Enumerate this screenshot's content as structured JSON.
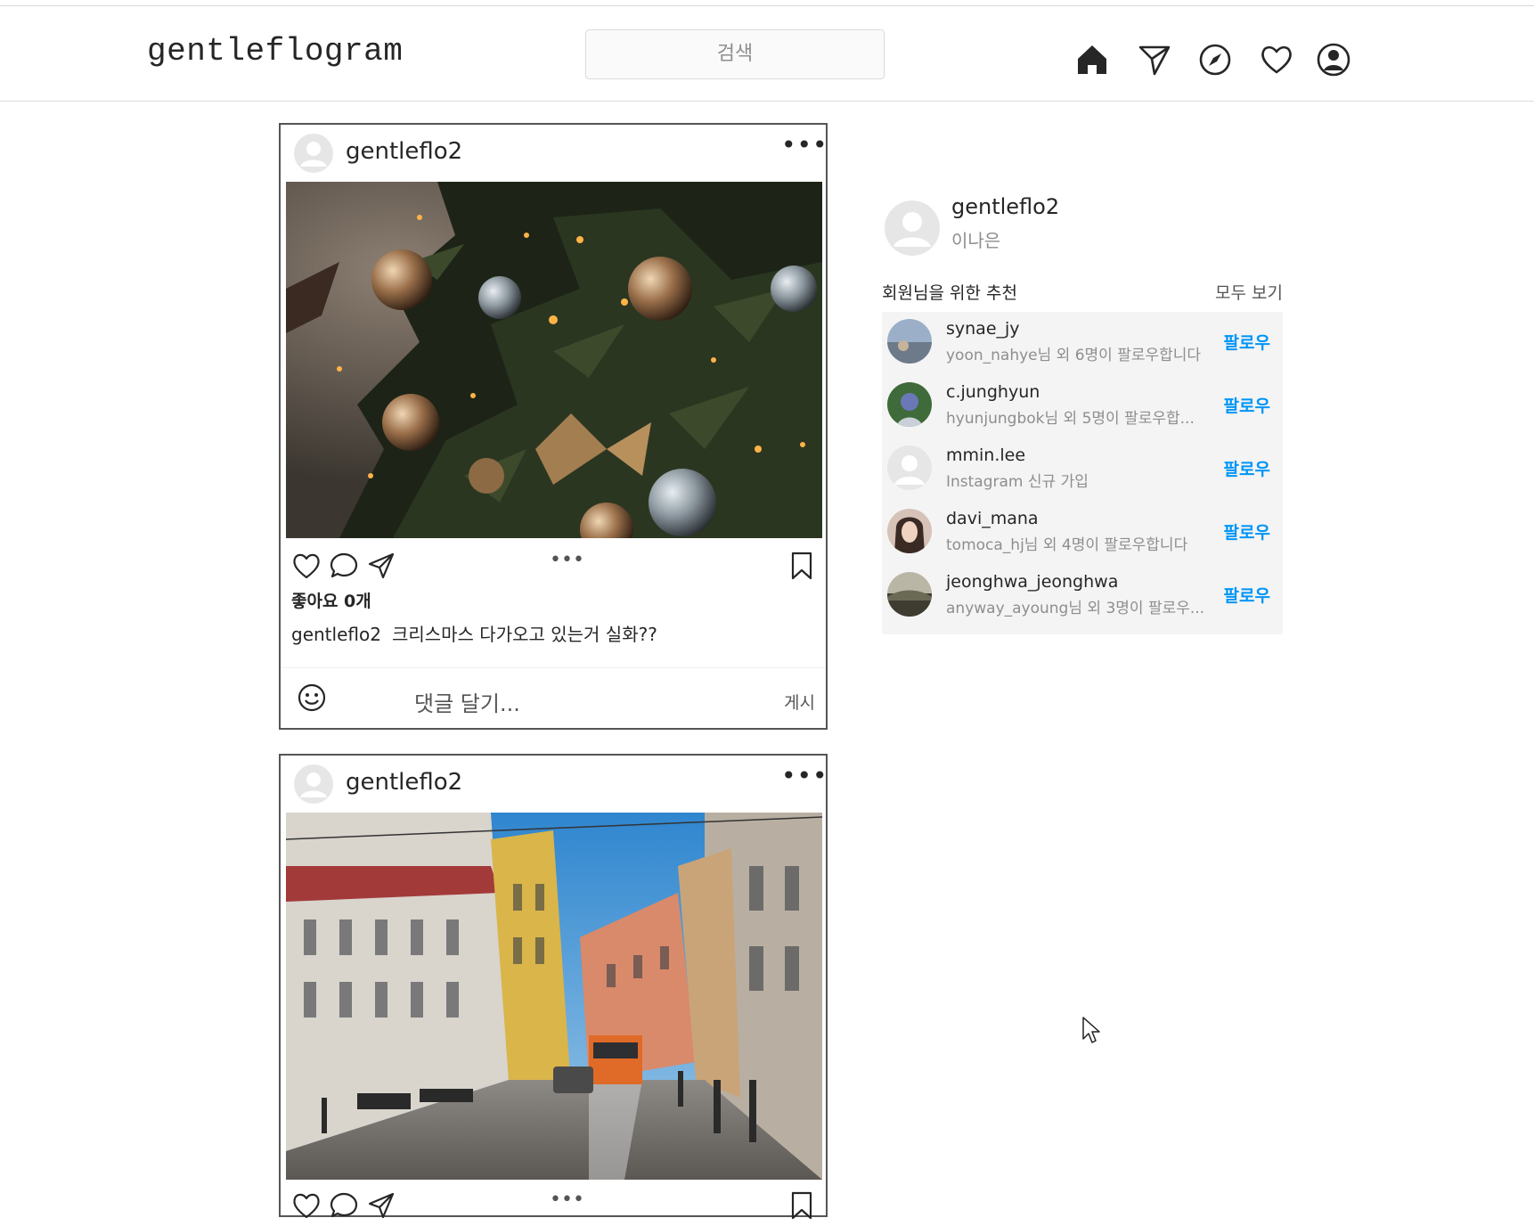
{
  "header": {
    "logo": "gentleflogram",
    "search_placeholder": "검색",
    "icons": [
      "home-icon",
      "direct-message-icon",
      "explore-compass-icon",
      "activity-heart-icon",
      "profile-icon"
    ]
  },
  "posts": [
    {
      "username": "gentleflo2",
      "more_label": "•••",
      "likes_text": "좋아요 0개",
      "caption_user": "gentleflo2",
      "caption_text": "크리스마스 다가오고 있는거 실화??",
      "comment_placeholder": "댓글 달기...",
      "post_button": "게시",
      "media_middle_dots": "•••"
    },
    {
      "username": "gentleflo2",
      "more_label": "•••",
      "media_middle_dots": "•••"
    }
  ],
  "sidebar": {
    "username": "gentleflo2",
    "subtitle": "이나은",
    "recommend_title": "회원님을 위한 추천",
    "see_all": "모두 보기",
    "suggestions": [
      {
        "name": "synae_jy",
        "sub": "yoon_nahye님 외 6명이 팔로우합니다",
        "follow": "팔로우"
      },
      {
        "name": "c.junghyun",
        "sub": "hyunjungbok님 외 5명이 팔로우합...",
        "follow": "팔로우"
      },
      {
        "name": "mmin.lee",
        "sub": "Instagram 신규 가입",
        "follow": "팔로우"
      },
      {
        "name": "davi_mana",
        "sub": "tomoca_hj님 외 4명이 팔로우합니다",
        "follow": "팔로우"
      },
      {
        "name": "jeonghwa_jeonghwa",
        "sub": "anyway_ayoung님 외 3명이 팔로우...",
        "follow": "팔로우"
      }
    ]
  }
}
